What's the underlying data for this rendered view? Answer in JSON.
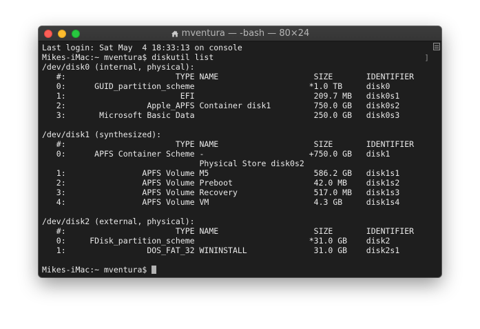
{
  "window": {
    "title": "mventura — -bash — 80×24"
  },
  "terminal": {
    "lines": [
      "Last login: Sat May  4 18:33:13 on console",
      "Mikes-iMac:~ mventura$ diskutil list",
      "/dev/disk0 (internal, physical):",
      "   #:                       TYPE NAME                    SIZE       IDENTIFIER",
      "   0:      GUID_partition_scheme                        *1.0 TB     disk0",
      "   1:                        EFI                         209.7 MB   disk0s1",
      "   2:                 Apple_APFS Container disk1         750.0 GB   disk0s2",
      "   3:       Microsoft Basic Data                         250.0 GB   disk0s3",
      "",
      "/dev/disk1 (synthesized):",
      "   #:                       TYPE NAME                    SIZE       IDENTIFIER",
      "   0:      APFS Container Scheme -                      +750.0 GB   disk1",
      "                                 Physical Store disk0s2",
      "   1:                APFS Volume M5                      586.2 GB   disk1s1",
      "   2:                APFS Volume Preboot                 42.0 MB    disk1s2",
      "   3:                APFS Volume Recovery                517.0 MB   disk1s3",
      "   4:                APFS Volume VM                      4.3 GB     disk1s4",
      "",
      "/dev/disk2 (external, physical):",
      "   #:                       TYPE NAME                    SIZE       IDENTIFIER",
      "   0:     FDisk_partition_scheme                        *31.0 GB    disk2",
      "   1:                 DOS_FAT_32 WININSTALL              31.0 GB    disk2s1",
      "",
      "Mikes-iMac:~ mventura$ "
    ]
  },
  "icons": {
    "window_close": "close-icon",
    "window_minimize": "minimize-icon",
    "window_zoom": "zoom-icon",
    "folder": "home-folder-icon"
  },
  "colors": {
    "background": "#1e1e1e",
    "text": "#e9e9e9",
    "titlebar": "#353535",
    "close": "#fc5f57",
    "minimize": "#fdbc2e",
    "zoom": "#28c840"
  }
}
